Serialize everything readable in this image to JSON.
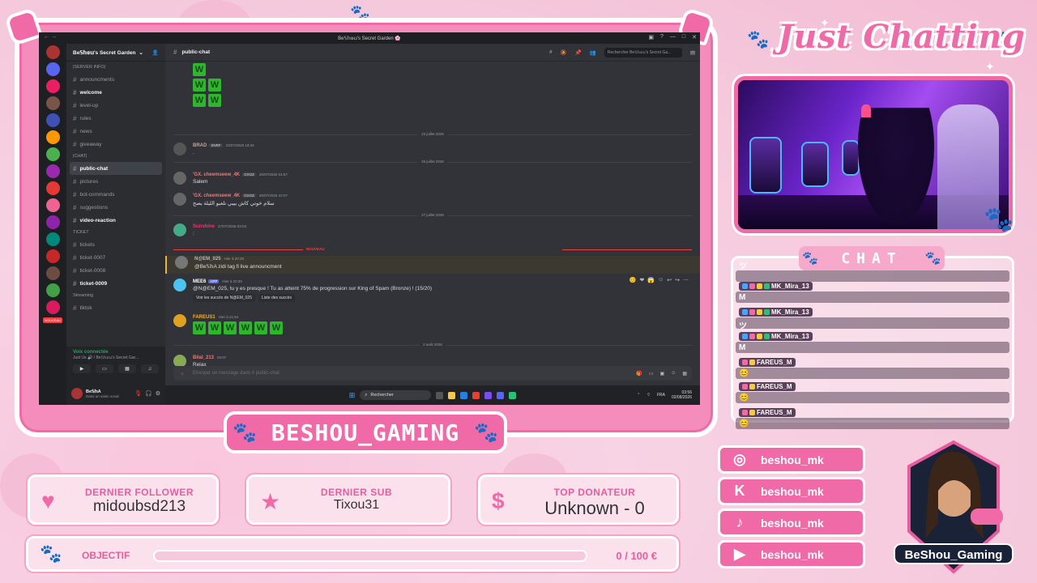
{
  "overlay": {
    "title": "Just Chatting",
    "banner": "BESHOU_GAMING",
    "chat_header": "CHAT",
    "last_follower": {
      "label": "DERNIER FOLLOWER",
      "value": "midoubsd213"
    },
    "last_sub": {
      "label": "DERNIER SUB",
      "value": "Tixou31"
    },
    "top_donor": {
      "label": "TOP DONATEUR",
      "value": "Unknown - 0"
    },
    "goal": {
      "label": "OBJECTIF",
      "value": "0 / 100 €",
      "progress": 0
    },
    "socials": [
      {
        "icon": "instagram-icon",
        "glyph": "◎",
        "handle": "beshou_mk"
      },
      {
        "icon": "kick-icon",
        "glyph": "K",
        "handle": "beshou_mk"
      },
      {
        "icon": "tiktok-icon",
        "glyph": "♪",
        "handle": "beshou_mk"
      },
      {
        "icon": "youtube-icon",
        "glyph": "▶",
        "handle": "beshou_mk"
      }
    ],
    "logo_text": "BeShou_Gaming",
    "chat_rows": [
      {
        "user": "",
        "msg": "ツ"
      },
      {
        "user": "MK_Mira_13",
        "msg": "M"
      },
      {
        "user": "MK_Mira_13",
        "msg": "ツ"
      },
      {
        "user": "MK_Mira_13",
        "msg": "M"
      },
      {
        "user": "FAREUS_M",
        "msg": "😊"
      },
      {
        "user": "FAREUS_M",
        "msg": "😊"
      },
      {
        "user": "FAREUS_M",
        "msg": "😊"
      }
    ]
  },
  "discord": {
    "window_title": "Be𝕊𝕙𝕠𝕦's Secret Garden 🌸",
    "server_name": "Be𝕊𝕙𝕠𝕦's Secret Garden",
    "channels": [
      {
        "name": "|SERVER INFO|",
        "kind": "cat"
      },
      {
        "name": "announcments",
        "kind": "chan"
      },
      {
        "name": "welcome",
        "kind": "bold"
      },
      {
        "name": "level-up",
        "kind": "chan"
      },
      {
        "name": "rules",
        "kind": "chan"
      },
      {
        "name": "news",
        "kind": "chan"
      },
      {
        "name": "giveaway",
        "kind": "chan"
      },
      {
        "name": "|CHAT|",
        "kind": "cat"
      },
      {
        "name": "public-chat",
        "kind": "sel"
      },
      {
        "name": "pictures",
        "kind": "chan"
      },
      {
        "name": "bot-commands",
        "kind": "chan"
      },
      {
        "name": "suggestions",
        "kind": "chan"
      },
      {
        "name": "video-reaction",
        "kind": "bold"
      },
      {
        "name": "TICKET",
        "kind": "cat"
      },
      {
        "name": "tickets",
        "kind": "chan"
      },
      {
        "name": "ticket-0007",
        "kind": "chan"
      },
      {
        "name": "ticket-0008",
        "kind": "chan"
      },
      {
        "name": "ticket-0009",
        "kind": "bold"
      },
      {
        "name": "Streaming",
        "kind": "cat"
      },
      {
        "name": "tiktok",
        "kind": "chan"
      }
    ],
    "voice_status": "Voix connectée",
    "voice_channel": "Just Us 🔊 / Be𝕊𝕙𝕠𝕦's Secret Gar...",
    "user_name": "Be𝕊𝕙A",
    "user_status": "Dans un salon vocal",
    "channel_header": "public-chat",
    "search_placeholder": "Rechercher Be𝕊𝕙𝕠𝕦's Secret Ga...",
    "dates": [
      "23 juillet 2026",
      "25 juillet 2026",
      "27 juillet 2026",
      "1 août 2026",
      "2 août 2026"
    ],
    "new_badge": "NOUVEAU",
    "messages": [
      {
        "name": "BRAD",
        "tag": "SNRF",
        "time": "23/07/2026 19:34",
        "text": ".",
        "color": "#c9a0a0"
      },
      {
        "name": "'GX. cheemseew_4K",
        "tag": "GXOZ",
        "time": "25/07/2026 01:57",
        "text": "Salem",
        "color": "#e87b7b"
      },
      {
        "name": "'GX. cheemseew_4K",
        "tag": "GXOZ",
        "time": "25/07/2026 22:07",
        "text": "سلام خوتي كاش ييبي نلعبو الليلة بصح",
        "color": "#e87b7b"
      },
      {
        "name": "Sunshine",
        "tag": "",
        "time": "27/07/2026 03:03",
        "text": ":",
        "color": "#e23b6b"
      },
      {
        "name": "N@EM_025",
        "tag": "",
        "time": "Hier à 20:29",
        "text": "@Be𝕊𝕙A zidi tag fi live announcment",
        "color": "#b5bac1"
      },
      {
        "name": "MEE6",
        "tag": "APP",
        "time": "Hier à 20:30",
        "text": "@N@EM_025, tu y es presque ! Tu as atteint 75% de progression sur King of Spam (Bronze) ! (15/20)",
        "color": "#ffffff"
      },
      {
        "name": "FAREUS1",
        "tag": "",
        "time": "Hier à 21:54",
        "text": "",
        "color": "#f0b232"
      },
      {
        "name": "Bilal_213",
        "tag": "",
        "time": "03:07",
        "text": "Relax",
        "color": "#e87b7b"
      }
    ],
    "mee6_btn1": "Voir les succès de N@EM_025",
    "mee6_btn2": "Liste des succès",
    "composer_placeholder": "Envoyer un message dans # public-chat",
    "taskbar_search": "Rechercher",
    "tray_lang": "FRA",
    "tray_time": "03:56",
    "tray_date": "02/08/2026"
  }
}
